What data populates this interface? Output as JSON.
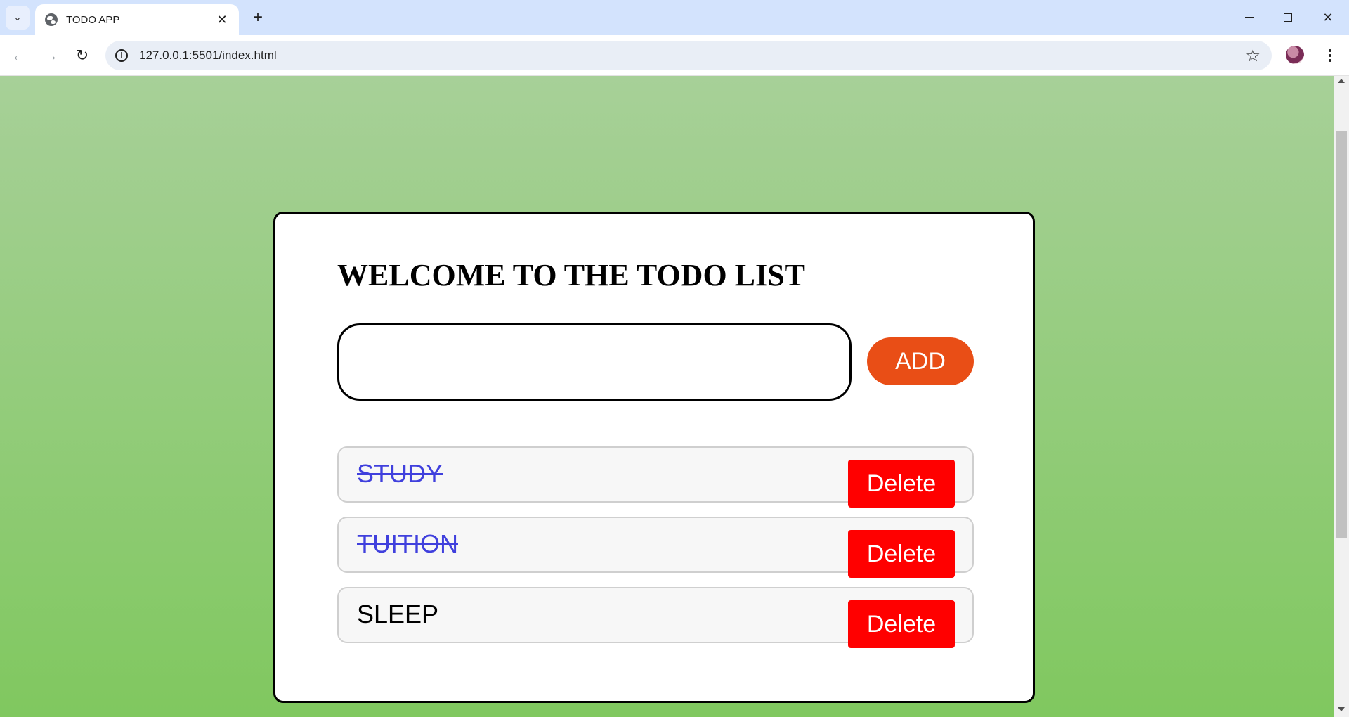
{
  "browser": {
    "tab_title": "TODO APP",
    "url": "127.0.0.1:5501/index.html",
    "icons": {
      "tab_menu": "chevron-down-icon",
      "favicon": "globe-icon",
      "tab_close": "close-icon",
      "new_tab": "plus-icon",
      "back": "arrow-left-icon",
      "forward": "arrow-right-icon",
      "reload": "reload-icon",
      "site_info": "info-icon",
      "bookmark": "star-icon",
      "menu": "kebab-icon"
    },
    "glyphs": {
      "tab_menu": "⌄",
      "tab_close": "✕",
      "new_tab": "+",
      "back": "←",
      "forward": "→",
      "reload": "↻",
      "site_info": "i",
      "bookmark": "☆",
      "close_window": "✕"
    }
  },
  "app": {
    "heading": "WELCOME TO THE TODO LIST",
    "input_value": "",
    "add_label": "ADD",
    "todos": [
      {
        "text": "STUDY",
        "completed": true,
        "delete_label": "Delete"
      },
      {
        "text": "TUITION",
        "completed": true,
        "delete_label": "Delete"
      },
      {
        "text": "SLEEP",
        "completed": false,
        "delete_label": "Delete"
      }
    ]
  },
  "colors": {
    "background_top": "#a7d098",
    "background_bottom": "#80c85f",
    "add_button": "#e94e16",
    "delete_button": "#ff0000",
    "completed_text": "#4040dd"
  }
}
